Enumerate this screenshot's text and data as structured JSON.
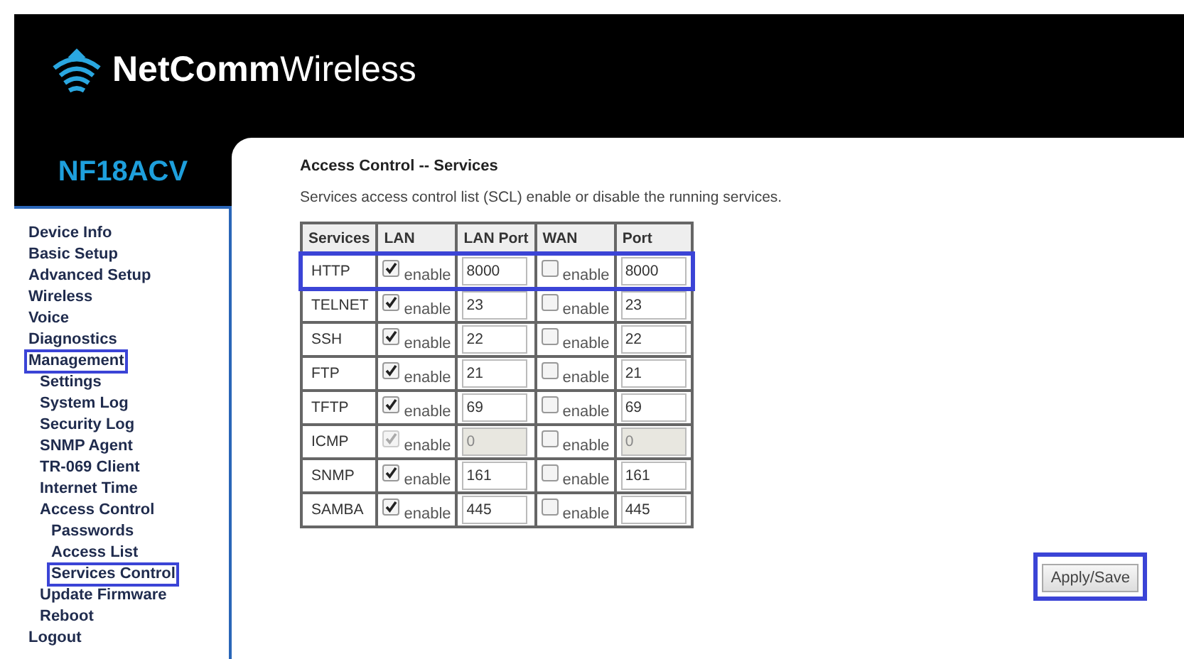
{
  "header": {
    "logo_text": "**NetComm**Wireless",
    "model": "NF18ACV"
  },
  "sidebar": {
    "items": [
      {
        "label": "Device Info",
        "highlighted": false
      },
      {
        "label": "Basic Setup",
        "highlighted": false
      },
      {
        "label": "Advanced Setup",
        "highlighted": false
      },
      {
        "label": "Wireless",
        "highlighted": false
      },
      {
        "label": "Voice",
        "highlighted": false
      },
      {
        "label": "Diagnostics",
        "highlighted": false
      },
      {
        "label": "Management",
        "highlighted": true,
        "children": [
          {
            "label": "Settings",
            "highlighted": false
          },
          {
            "label": "System Log",
            "highlighted": false
          },
          {
            "label": "Security Log",
            "highlighted": false
          },
          {
            "label": "SNMP Agent",
            "highlighted": false
          },
          {
            "label": "TR-069 Client",
            "highlighted": false
          },
          {
            "label": "Internet Time",
            "highlighted": false
          },
          {
            "label": "Access Control",
            "highlighted": false,
            "children": [
              {
                "label": "Passwords",
                "highlighted": false
              },
              {
                "label": "Access List",
                "highlighted": false
              },
              {
                "label": "Services Control",
                "highlighted": true
              }
            ]
          },
          {
            "label": "Update Firmware",
            "highlighted": false
          },
          {
            "label": "Reboot",
            "highlighted": false
          }
        ]
      },
      {
        "label": "Logout",
        "highlighted": false
      }
    ]
  },
  "content": {
    "title": "Access Control -- Services",
    "description": "Services access control list (SCL) enable or disable the running services.",
    "table": {
      "columns": [
        "Services",
        "LAN",
        "LAN Port",
        "WAN",
        "Port"
      ],
      "rows": [
        {
          "service": "HTTP",
          "lan_checked": true,
          "lan_label": "enable",
          "lan_port": "8000",
          "wan_checked": false,
          "wan_label": "enable",
          "wan_port": "8000",
          "disabled": false,
          "highlighted": true
        },
        {
          "service": "TELNET",
          "lan_checked": true,
          "lan_label": "enable",
          "lan_port": "23",
          "wan_checked": false,
          "wan_label": "enable",
          "wan_port": "23",
          "disabled": false,
          "highlighted": false
        },
        {
          "service": "SSH",
          "lan_checked": true,
          "lan_label": "enable",
          "lan_port": "22",
          "wan_checked": false,
          "wan_label": "enable",
          "wan_port": "22",
          "disabled": false,
          "highlighted": false
        },
        {
          "service": "FTP",
          "lan_checked": true,
          "lan_label": "enable",
          "lan_port": "21",
          "wan_checked": false,
          "wan_label": "enable",
          "wan_port": "21",
          "disabled": false,
          "highlighted": false
        },
        {
          "service": "TFTP",
          "lan_checked": true,
          "lan_label": "enable",
          "lan_port": "69",
          "wan_checked": false,
          "wan_label": "enable",
          "wan_port": "69",
          "disabled": false,
          "highlighted": false
        },
        {
          "service": "ICMP",
          "lan_checked": true,
          "lan_label": "enable",
          "lan_port": "0",
          "wan_checked": false,
          "wan_label": "enable",
          "wan_port": "0",
          "disabled": true,
          "highlighted": false
        },
        {
          "service": "SNMP",
          "lan_checked": true,
          "lan_label": "enable",
          "lan_port": "161",
          "wan_checked": false,
          "wan_label": "enable",
          "wan_port": "161",
          "disabled": false,
          "highlighted": false
        },
        {
          "service": "SAMBA",
          "lan_checked": true,
          "lan_label": "enable",
          "lan_port": "445",
          "wan_checked": false,
          "wan_label": "enable",
          "wan_port": "445",
          "disabled": false,
          "highlighted": false
        }
      ]
    },
    "apply_button": {
      "label": "Apply/Save",
      "highlighted": true
    }
  }
}
